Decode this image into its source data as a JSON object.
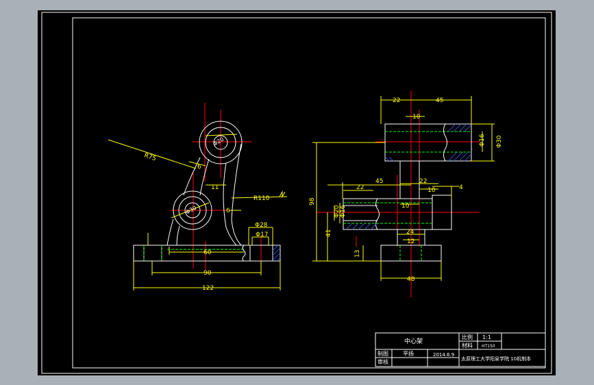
{
  "colors": {
    "background": "#a9b0b6",
    "paper": "#000000",
    "frame": "#ffffff",
    "outline": "#ffffff",
    "dimension": "#ffff00",
    "centerline": "#ff0000",
    "hidden": "#00ff00",
    "hatch": "#3050c8",
    "text": "#ffffff"
  },
  "front_view": {
    "dims": {
      "r75": "R75",
      "r110": "R110",
      "d_top": "Φ20",
      "d_bottom": "Φ30",
      "d28": "Φ28",
      "d17": "Φ17",
      "w6a": "6",
      "w11": "11",
      "w6b": "6",
      "w60": "60",
      "w90": "90",
      "w122": "122"
    }
  },
  "side_view": {
    "dims": {
      "w22_top": "22",
      "w45_top": "45",
      "w10_top": "10",
      "d16": "Φ16",
      "d30": "Φ30",
      "h98": "98",
      "w45_mid": "45",
      "w22_mid": "22",
      "w22_left": "22",
      "w10_mid": "10",
      "w10_right": "10",
      "w4": "4",
      "d20_left": "Φ20",
      "d16_left": "Φ16",
      "h41": "41",
      "w24": "24",
      "w12": "12",
      "h13": "13",
      "w48": "48"
    }
  },
  "title_block": {
    "part_name": "中心架",
    "scale_label": "比例",
    "scale_value": "1:1",
    "material_label": "材料",
    "material_value": "HT150",
    "drawn_label": "制图",
    "drawn_name": "平扬",
    "date": "2014.6.9",
    "checked_label": "审核",
    "school": "太原理工大学阳泉学院 10机制本"
  }
}
